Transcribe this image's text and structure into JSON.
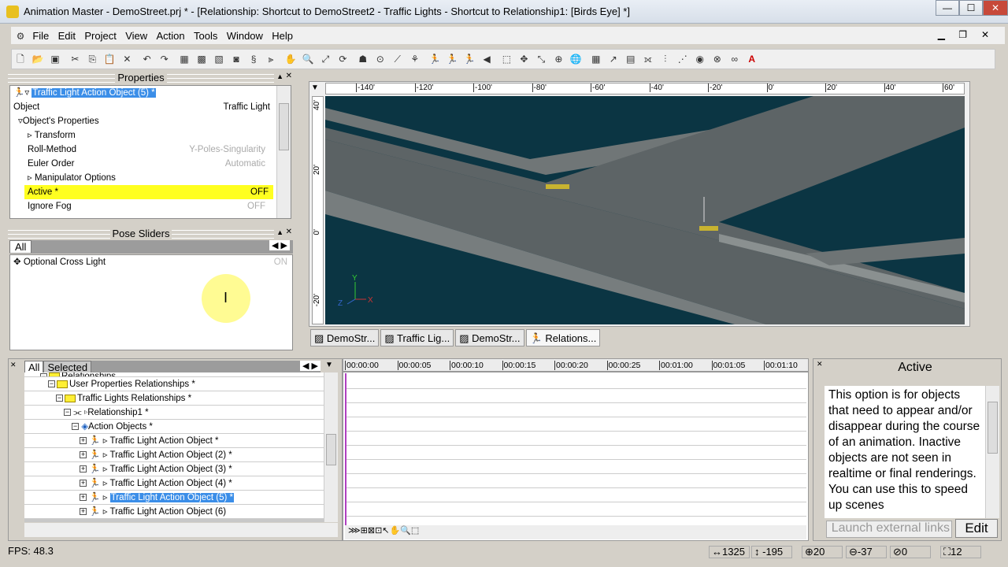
{
  "window": {
    "title": "Animation Master - DemoStreet.prj * - [Relationship: Shortcut to DemoStreet2 - Traffic Lights - Shortcut to Relationship1:  [Birds Eye] *]",
    "min": "—",
    "max": "☐",
    "close": "✕"
  },
  "menu": [
    "File",
    "Edit",
    "Project",
    "View",
    "Action",
    "Tools",
    "Window",
    "Help"
  ],
  "properties": {
    "title": "Properties",
    "selected": "Traffic Light Action Object (5) *",
    "rows": [
      {
        "label": "Object",
        "value": "Traffic Light"
      },
      {
        "label": "Object's Properties",
        "value": ""
      },
      {
        "label": "Transform",
        "value": ""
      },
      {
        "label": "Roll-Method",
        "value": "Y-Poles-Singularity"
      },
      {
        "label": "Euler Order",
        "value": "Automatic"
      },
      {
        "label": "Manipulator Options",
        "value": ""
      },
      {
        "label": "Active *",
        "value": "OFF"
      },
      {
        "label": "Ignore Fog",
        "value": "OFF"
      }
    ]
  },
  "pose_sliders": {
    "title": "Pose Sliders",
    "tab": "All",
    "items": [
      {
        "label": "Optional Cross Light",
        "value": "ON"
      }
    ]
  },
  "viewport": {
    "ruler_x": [
      "-140'",
      "-120'",
      "-100'",
      "-80'",
      "-60'",
      "-40'",
      "-20'",
      "0'",
      "20'",
      "40'",
      "60'"
    ],
    "ruler_y": [
      "40'",
      "20'",
      "0'",
      "-20'"
    ],
    "axes": {
      "x": "X",
      "y": "Y",
      "z": "Z"
    },
    "tabs": [
      "DemoStr...",
      "Traffic Lig...",
      "DemoStr...",
      "Relations..."
    ],
    "colors": {
      "ground": "#0b3543",
      "road": "#5b6264"
    }
  },
  "tree": {
    "tabs": [
      "All",
      "Selected"
    ],
    "items": [
      {
        "label": "Relationships",
        "indent": 0
      },
      {
        "label": "User Properties Relationships *",
        "indent": 1
      },
      {
        "label": "Traffic Lights Relationships *",
        "indent": 2
      },
      {
        "label": "Relationship1 *",
        "indent": 3
      },
      {
        "label": "Action Objects *",
        "indent": 4
      },
      {
        "label": "Traffic Light Action Object *",
        "indent": 5
      },
      {
        "label": "Traffic Light Action Object (2) *",
        "indent": 5
      },
      {
        "label": "Traffic Light Action Object (3) *",
        "indent": 5
      },
      {
        "label": "Traffic Light Action Object (4) *",
        "indent": 5
      },
      {
        "label": "Traffic Light Action Object (5) *",
        "indent": 5
      },
      {
        "label": "Traffic Light Action Object (6)",
        "indent": 5
      }
    ]
  },
  "timeline": {
    "ticks": [
      "00:00:00",
      "00:00:05",
      "00:00:10",
      "00:00:15",
      "00:00:20",
      "00:00:25",
      "00:01:00",
      "00:01:05",
      "00:01:10"
    ]
  },
  "help": {
    "title": "Active",
    "text": "This option is for objects that need to appear and/or disappear during the course of an animation. Inactive objects are not seen in realtime or final renderings. You can use this to speed up scenes",
    "launch": "Launch external links",
    "edit": "Edit"
  },
  "status": {
    "fps": "FPS: 48.3",
    "x": "1325",
    "y": "-195",
    "a": "20",
    "b": "-37",
    "c": "0",
    "d": "12"
  }
}
